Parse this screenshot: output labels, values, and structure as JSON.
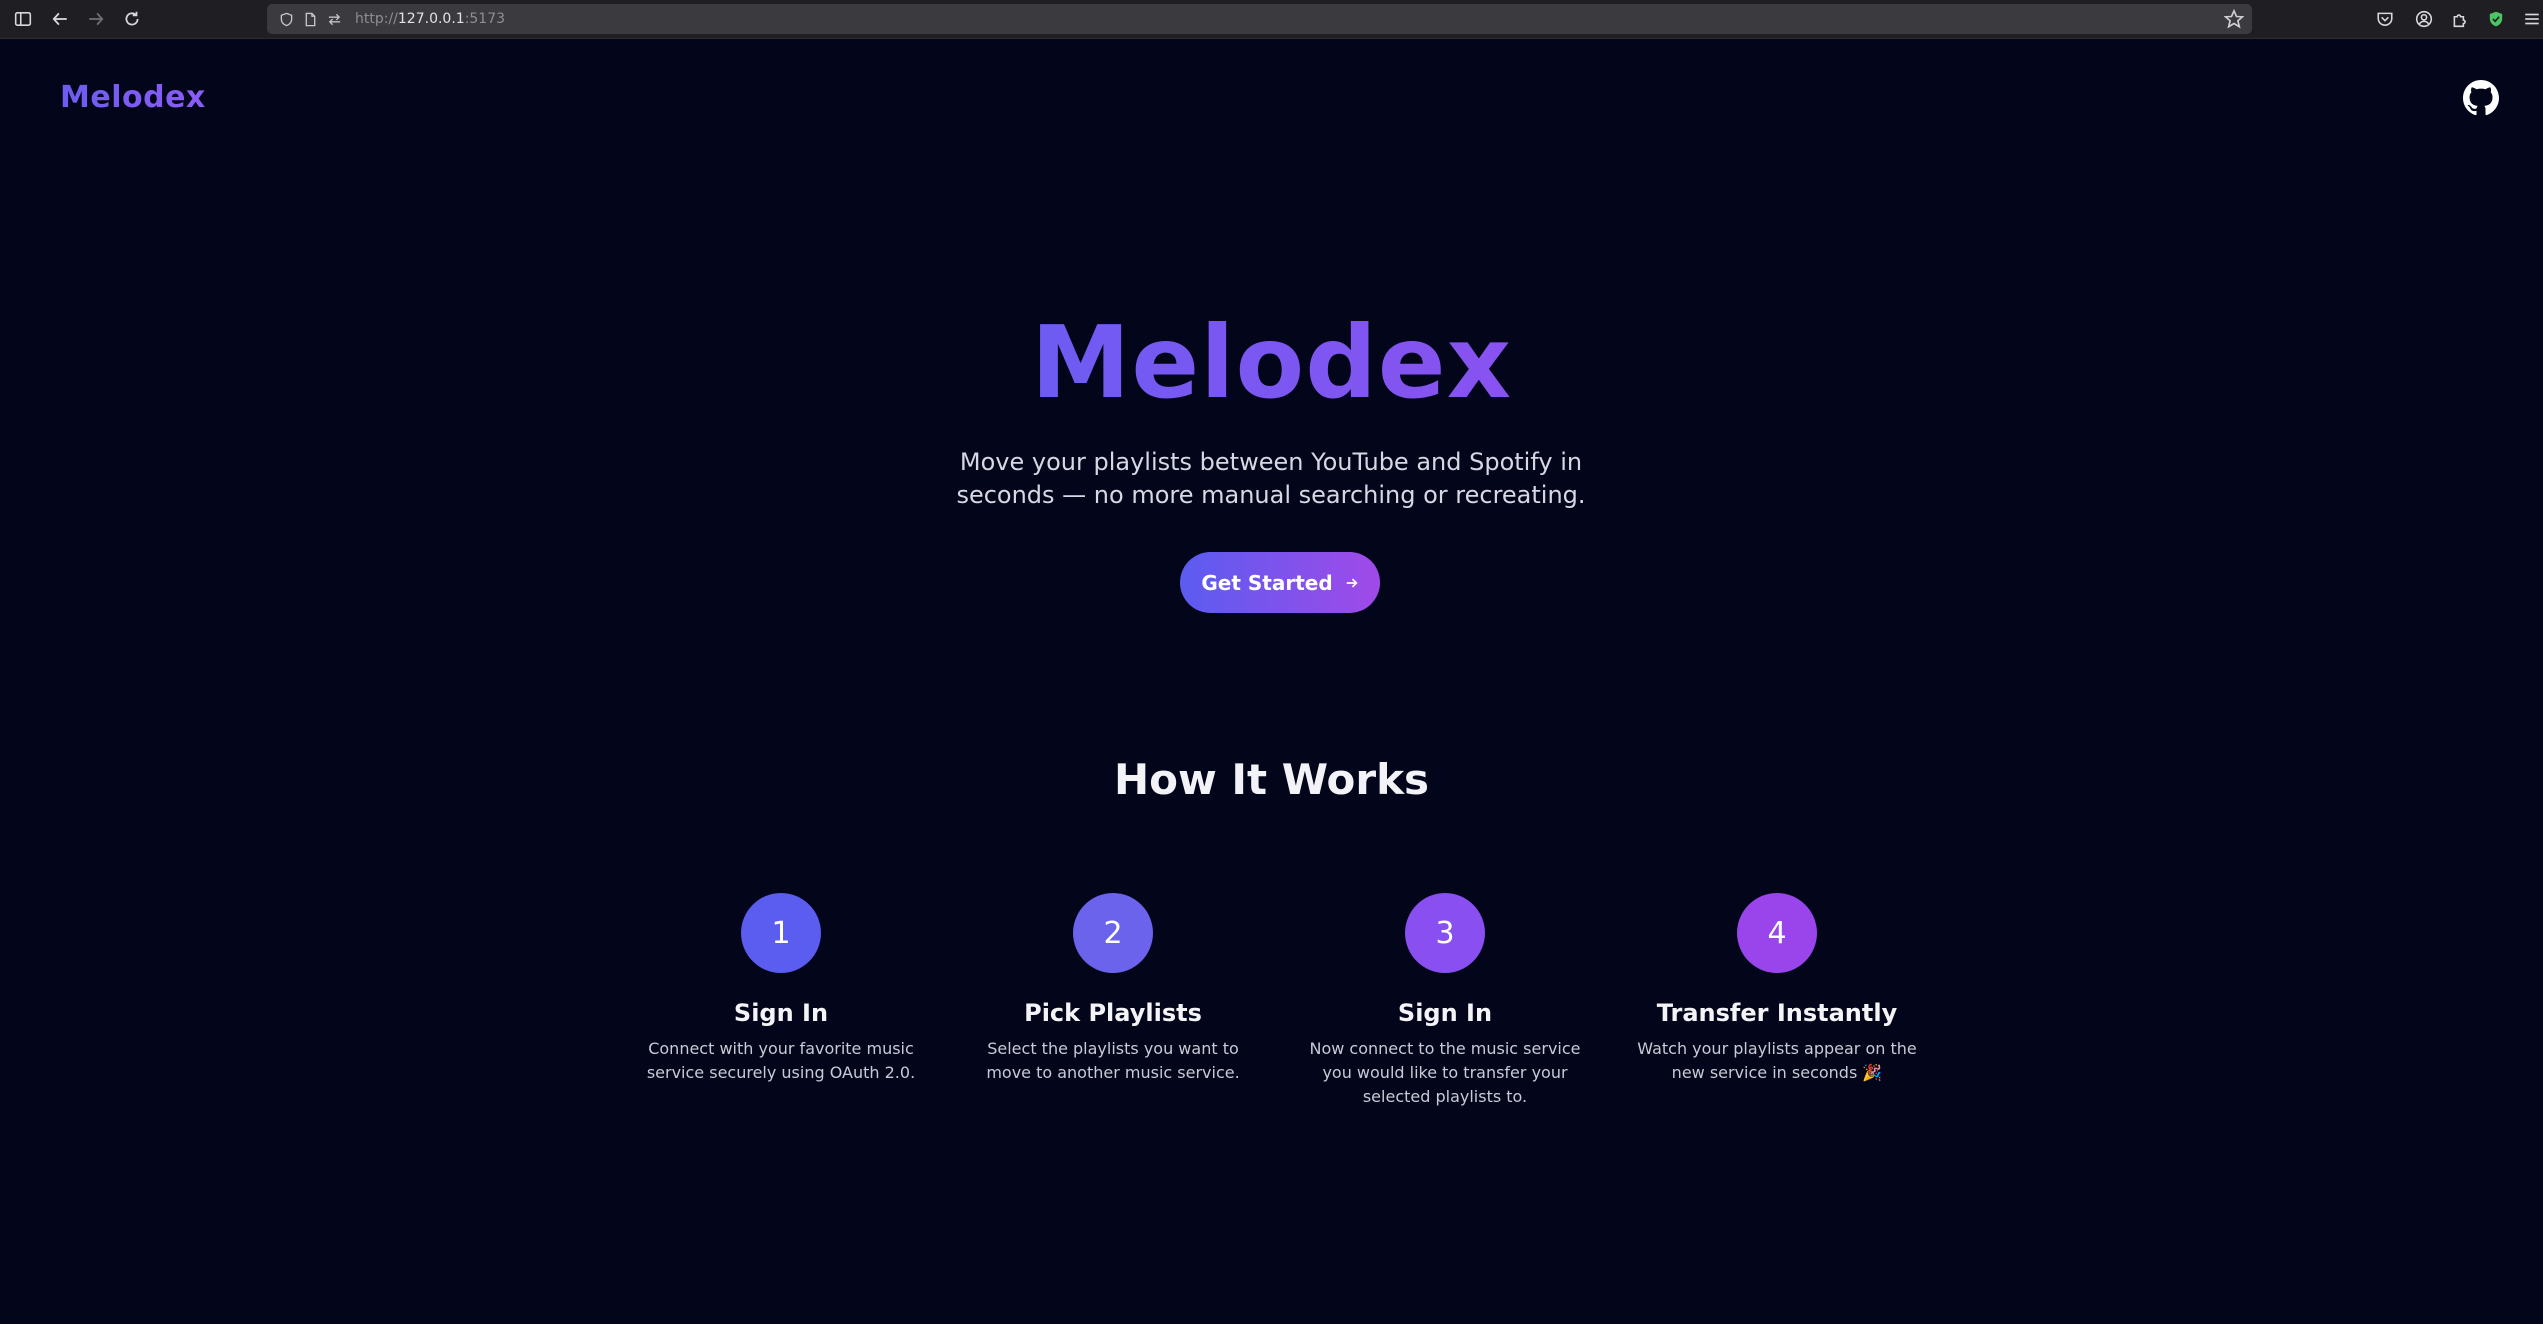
{
  "browser": {
    "url_scheme": "http://",
    "url_host": "127.0.0.1",
    "url_port": ":5173"
  },
  "header": {
    "brand": "Melodex",
    "github_icon": "github-icon"
  },
  "hero": {
    "title": "Melodex",
    "subtitle": "Move your playlists between YouTube and Spotify in seconds — no more manual searching or recreating.",
    "cta_label": "Get Started",
    "cta_icon": "arrow-right-icon"
  },
  "how_it_works": {
    "title": "How It Works",
    "steps": [
      {
        "number": "1",
        "title": "Sign In",
        "description": "Connect with your favorite music service securely using OAuth 2.0.",
        "color": "#5b5cf0"
      },
      {
        "number": "2",
        "title": "Pick Playlists",
        "description": "Select the playlists you want to move to another music service.",
        "color": "#6b63ec"
      },
      {
        "number": "3",
        "title": "Sign In",
        "description": "Now connect to the music service you would like to transfer your selected playlists to.",
        "color": "#8a4ff0"
      },
      {
        "number": "4",
        "title": "Transfer Instantly",
        "description": "Watch your playlists appear on the new service in seconds 🎉",
        "color": "#9a45eb"
      }
    ]
  },
  "colors": {
    "background": "#03051a",
    "accent_start": "#5b5cf0",
    "accent_end": "#a04ae8"
  }
}
